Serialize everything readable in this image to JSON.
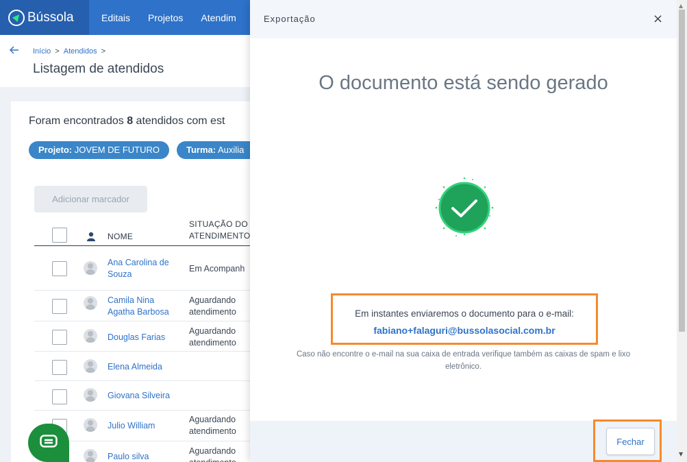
{
  "app": {
    "name": "Bússola"
  },
  "nav": {
    "items": [
      "Editais",
      "Projetos",
      "Atendim"
    ]
  },
  "breadcrumb": {
    "items": [
      "Início",
      "Atendidos"
    ],
    "sep": ">"
  },
  "page": {
    "title": "Listagem de atendidos"
  },
  "results": {
    "prefix": "Foram encontrados",
    "count": "8",
    "suffix": "atendidos com est"
  },
  "filters": [
    {
      "key": "Projeto:",
      "value": "JOVEM DE FUTURO"
    },
    {
      "key": "Turma:",
      "value": "Auxilia"
    }
  ],
  "toolbar": {
    "add_marker_label": "Adicionar marcador"
  },
  "table": {
    "headers": {
      "name": "NOME",
      "status_line1": "SITUAÇÃO DO",
      "status_line2": "ATENDIMENTO"
    },
    "rows": [
      {
        "name": "Ana Carolina de Souza",
        "status": "Em Acompanh"
      },
      {
        "name": "Camila Nina Agatha Barbosa",
        "status": "Aguardando atendimento"
      },
      {
        "name": "Douglas Farias",
        "status": "Aguardando atendimento"
      },
      {
        "name": "Elena Almeida",
        "status": ""
      },
      {
        "name": "Giovana Silveira",
        "status": ""
      },
      {
        "name": "Julio William",
        "status": "Aguardando atendimento"
      },
      {
        "name": "Paulo silva",
        "status": "Aguardando atendimento"
      }
    ]
  },
  "modal": {
    "title": "Exportação",
    "close_icon": "×",
    "heading": "O documento está sendo gerado",
    "email_text": "Em instantes enviaremos o documento para o e-mail:",
    "email": "fabiano+falaguri@bussolasocial.com.br",
    "hint": "Caso não encontre o e-mail na sua caixa de entrada verifique também as caixas de spam e lixo eletrônico.",
    "close_button": "Fechar"
  },
  "colors": {
    "primary": "#2e72c9",
    "success": "#1fa35a",
    "highlight": "#f58a2c",
    "chat": "#1b8f3c"
  },
  "icons": {
    "back": "arrow-left-icon",
    "user": "user-icon",
    "success": "check-circle-icon",
    "chat": "chat-icon"
  }
}
